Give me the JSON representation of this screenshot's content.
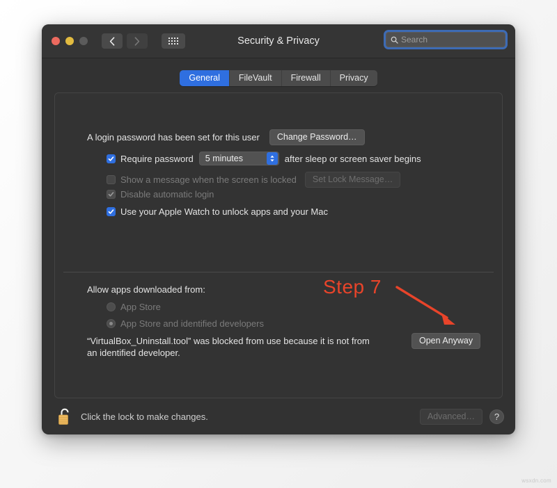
{
  "window": {
    "title": "Security & Privacy",
    "search": {
      "placeholder": "Search",
      "value": ""
    },
    "traffic_lights": [
      "close",
      "minimize",
      "zoom"
    ],
    "nav": {
      "back": "‹",
      "forward": "›",
      "grid": "show-all"
    }
  },
  "tabs": [
    {
      "label": "General",
      "active": true
    },
    {
      "label": "FileVault",
      "active": false
    },
    {
      "label": "Firewall",
      "active": false
    },
    {
      "label": "Privacy",
      "active": false
    }
  ],
  "general": {
    "login_password_text": "A login password has been set for this user",
    "change_password_button": "Change Password…",
    "require_password": {
      "label": "Require password",
      "checked": true,
      "interval": "5 minutes",
      "suffix": "after sleep or screen saver begins"
    },
    "show_message": {
      "label": "Show a message when the screen is locked",
      "checked": false,
      "disabled": true,
      "button": "Set Lock Message…"
    },
    "disable_auto_login": {
      "label": "Disable automatic login",
      "checked": true,
      "disabled": true
    },
    "apple_watch": {
      "label": "Use your Apple Watch to unlock apps and your Mac",
      "checked": true
    }
  },
  "download_section": {
    "heading": "Allow apps downloaded from:",
    "options": [
      {
        "label": "App Store",
        "selected": false,
        "disabled": true
      },
      {
        "label": "App Store and identified developers",
        "selected": true,
        "disabled": true
      }
    ],
    "blocked_message": "“VirtualBox_Uninstall.tool” was blocked from use because it is not from an identified developer.",
    "open_anyway_button": "Open Anyway"
  },
  "bottom_bar": {
    "lock_icon": "unlocked-padlock",
    "lock_text": "Click the lock to make changes.",
    "advanced_button": "Advanced…",
    "advanced_disabled": true,
    "help_button": "?"
  },
  "annotation": {
    "step_label": "Step 7",
    "arrow_color": "#e8442a",
    "text_color": "#e8442a"
  },
  "watermark": "wsxdn.com",
  "colors": {
    "accent_blue": "#2f6fe0",
    "window_bg": "#323232",
    "panel_bg": "#333333",
    "text_primary": "#e4e4e4",
    "text_dim": "#7b7b7b",
    "lock_gold": "#edb95f"
  }
}
